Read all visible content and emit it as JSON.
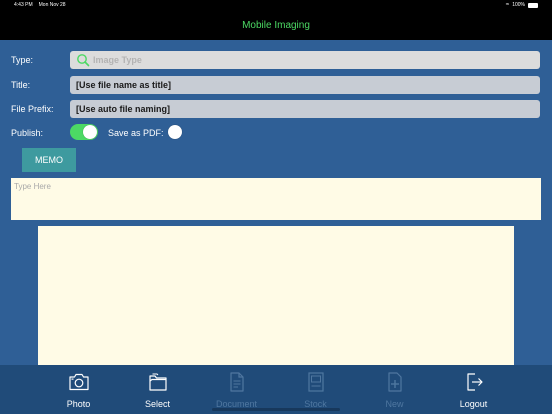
{
  "status_bar": {
    "time": "4:43 PM",
    "date": "Mon Nov 28",
    "battery": "100%"
  },
  "nav": {
    "title": "Mobile Imaging"
  },
  "form": {
    "type_label": "Type:",
    "type_placeholder": "Image Type",
    "title_label": "Title:",
    "title_value": "[Use file name as title]",
    "prefix_label": "File Prefix:",
    "prefix_value": "[Use auto file naming]",
    "publish_label": "Publish:",
    "publish_on": true,
    "pdf_label": "Save as PDF:",
    "pdf_on": false
  },
  "memo": {
    "button_label": "MEMO",
    "placeholder": "Type Here"
  },
  "tabs": [
    {
      "label": "Photo",
      "icon": "camera-icon",
      "enabled": true
    },
    {
      "label": "Select",
      "icon": "folder-icon",
      "enabled": true
    },
    {
      "label": "Document",
      "icon": "document-icon",
      "enabled": false
    },
    {
      "label": "Stock",
      "icon": "stock-icon",
      "enabled": false
    },
    {
      "label": "New",
      "icon": "new-file-icon",
      "enabled": false
    },
    {
      "label": "Logout",
      "icon": "logout-icon",
      "enabled": true
    }
  ],
  "colors": {
    "background": "#2f5f96",
    "nav_title": "#4cd964",
    "memo_button": "#3e9a9f",
    "memo_area": "#fffbe6",
    "tab_bar": "#204b79"
  }
}
